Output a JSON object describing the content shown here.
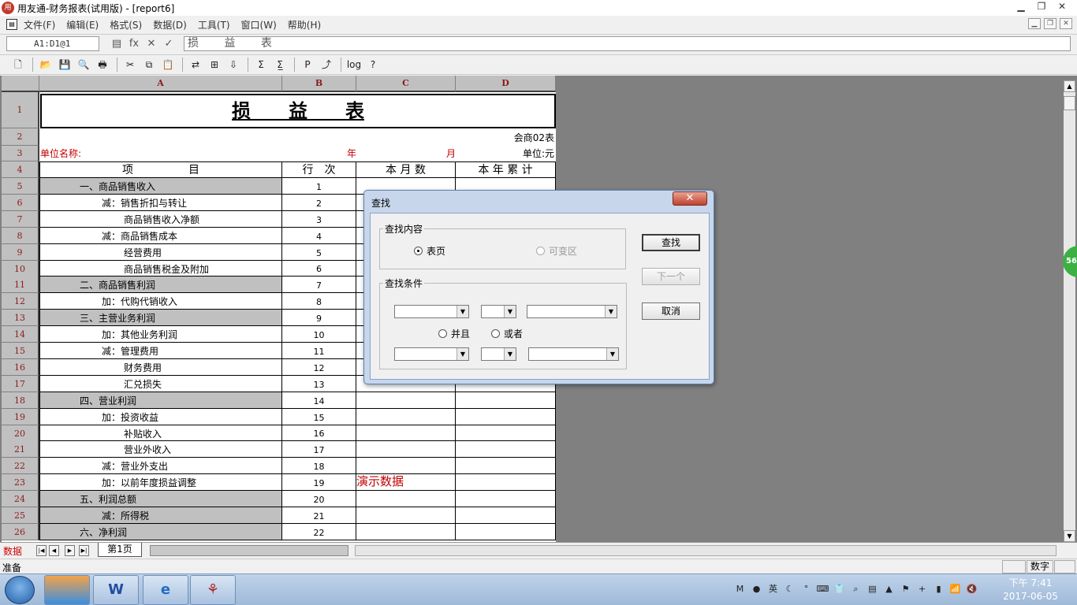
{
  "window": {
    "title": "用友通-财务报表(试用版) - [report6]",
    "app_icon": "yonyou-app-icon",
    "buttons": [
      "minimize",
      "maximize",
      "close"
    ]
  },
  "menubar": {
    "items": [
      "文件(F)",
      "编辑(E)",
      "格式(S)",
      "数据(D)",
      "工具(T)",
      "窗口(W)",
      "帮助(H)"
    ]
  },
  "formula_bar": {
    "cell_ref": "A1:D1@1",
    "fx_label": "fx",
    "cancel_symbol": "✕",
    "confirm_symbol": "✓",
    "content": "损 益 表"
  },
  "toolbar": {
    "icons": [
      "new-icon",
      "open-icon",
      "save-icon",
      "print-preview-icon",
      "print-icon",
      "cut-icon",
      "copy-icon",
      "paste-icon",
      "insert-icon",
      "format-icon",
      "sort-icon",
      "sum-icon",
      "subtotal-icon",
      "p-icon",
      "export-icon",
      "log-icon",
      "help-icon"
    ],
    "glyphs": [
      "🗋",
      "📂",
      "💾",
      "🔍",
      "🖶",
      "✂",
      "⧉",
      "📋",
      "⇄",
      "⊞",
      "⇩",
      "Σ",
      "Σ̲",
      "P",
      "⤴",
      "log",
      "?"
    ]
  },
  "sheet": {
    "columns": [
      "A",
      "B",
      "C",
      "D"
    ],
    "title": "损　　益　　表",
    "code": "会商02表",
    "unit_name_label": "单位名称:",
    "year_label": "年",
    "month_label": "月",
    "unit_label": "单位:元",
    "headers": [
      "项　　　　　目",
      "行　次",
      "本 月 数",
      "本 年 累 计"
    ],
    "watermark": "演示数据",
    "rows": [
      {
        "num": "5",
        "item": "一、商品销售收入",
        "line": "1",
        "indent": 1,
        "gray": true
      },
      {
        "num": "6",
        "item": "减：销售折扣与转让",
        "line": "2",
        "indent": 2,
        "gray": false
      },
      {
        "num": "7",
        "item": "商品销售收入净额",
        "line": "3",
        "indent": 3,
        "gray": false
      },
      {
        "num": "8",
        "item": "减：商品销售成本",
        "line": "4",
        "indent": 2,
        "gray": false
      },
      {
        "num": "9",
        "item": "经营费用",
        "line": "5",
        "indent": 3,
        "gray": false
      },
      {
        "num": "10",
        "item": "商品销售税金及附加",
        "line": "6",
        "indent": 3,
        "gray": false
      },
      {
        "num": "11",
        "item": "二、商品销售利润",
        "line": "7",
        "indent": 1,
        "gray": true
      },
      {
        "num": "12",
        "item": "加：代购代销收入",
        "line": "8",
        "indent": 2,
        "gray": false
      },
      {
        "num": "13",
        "item": "三、主营业务利润",
        "line": "9",
        "indent": 1,
        "gray": true
      },
      {
        "num": "14",
        "item": "加：其他业务利润",
        "line": "10",
        "indent": 2,
        "gray": false
      },
      {
        "num": "15",
        "item": "减：管理费用",
        "line": "11",
        "indent": 2,
        "gray": false
      },
      {
        "num": "16",
        "item": "财务费用",
        "line": "12",
        "indent": 3,
        "gray": false
      },
      {
        "num": "17",
        "item": "汇兑损失",
        "line": "13",
        "indent": 3,
        "gray": false
      },
      {
        "num": "18",
        "item": "四、营业利润",
        "line": "14",
        "indent": 1,
        "gray": true
      },
      {
        "num": "19",
        "item": "加：投资收益",
        "line": "15",
        "indent": 2,
        "gray": false
      },
      {
        "num": "20",
        "item": "补贴收入",
        "line": "16",
        "indent": 3,
        "gray": false
      },
      {
        "num": "21",
        "item": "营业外收入",
        "line": "17",
        "indent": 3,
        "gray": false
      },
      {
        "num": "22",
        "item": "减：营业外支出",
        "line": "18",
        "indent": 2,
        "gray": false
      },
      {
        "num": "23",
        "item": "加：以前年度损益调整",
        "line": "19",
        "indent": 2,
        "gray": false
      },
      {
        "num": "24",
        "item": "五、利润总额",
        "line": "20",
        "indent": 1,
        "gray": true
      },
      {
        "num": "25",
        "item": "减：所得税",
        "line": "21",
        "indent": 2,
        "gray": true
      },
      {
        "num": "26",
        "item": "六、净利润",
        "line": "22",
        "indent": 1,
        "gray": true
      }
    ]
  },
  "tabbar": {
    "data_label": "数据",
    "sheet_tab": "第1页"
  },
  "statusbar": {
    "status": "准备",
    "mode": "数字"
  },
  "side_badge": "56",
  "dialog": {
    "title": "查找",
    "close": "✕",
    "group_content": "查找内容",
    "radio_page": "表页",
    "radio_variable": "可变区",
    "group_condition": "查找条件",
    "radio_and": "并且",
    "radio_or": "或者",
    "btn_find": "查找",
    "btn_next": "下一个",
    "btn_cancel": "取消"
  },
  "taskbar": {
    "apps": [
      "W",
      "e",
      "⚘"
    ],
    "tray_glyphs": [
      "M",
      "●",
      "英",
      "☾",
      "°",
      "⌨",
      "👕",
      "⌕",
      "▤",
      "▲",
      "⚑",
      "+",
      "▮",
      "📶",
      "🔇"
    ],
    "time": "下午 7:41",
    "date": "2017-06-05"
  },
  "colors": {
    "header_red": "#8b1a1a",
    "label_red": "#c00000",
    "gray_cell": "#c0c0c0"
  }
}
